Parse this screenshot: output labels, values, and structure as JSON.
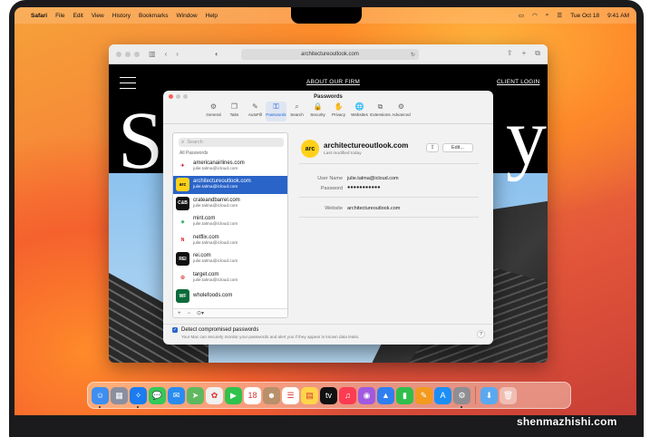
{
  "menubar": {
    "apple_icon": "apple-logo-icon",
    "app_name": "Safari",
    "items": [
      "File",
      "Edit",
      "View",
      "History",
      "Bookmarks",
      "Window",
      "Help"
    ],
    "date": "Tue Oct 18",
    "time": "9:41 AM",
    "status_icons": [
      "battery-icon",
      "wifi-icon",
      "search-icon",
      "control-center-icon"
    ]
  },
  "safari": {
    "url": "architectureoutlook.com",
    "site": {
      "nav_about": "ABOUT OUR FIRM",
      "nav_client": "CLIENT LOGIN",
      "big_left": "S",
      "big_right": "y"
    }
  },
  "passwords": {
    "title": "Passwords",
    "tabs": [
      {
        "label": "General",
        "icon": "gear-icon",
        "glyph": "⚙"
      },
      {
        "label": "Tabs",
        "icon": "tabs-icon",
        "glyph": "❐"
      },
      {
        "label": "AutoFill",
        "icon": "autofill-pen-icon",
        "glyph": "✎"
      },
      {
        "label": "Passwords",
        "icon": "key-icon",
        "glyph": "⚿"
      },
      {
        "label": "Search",
        "icon": "magnifier-icon",
        "glyph": "⌕"
      },
      {
        "label": "Security",
        "icon": "lock-icon",
        "glyph": "🔒"
      },
      {
        "label": "Privacy",
        "icon": "hand-icon",
        "glyph": "✋"
      },
      {
        "label": "Websites",
        "icon": "globe-icon",
        "glyph": "🌐"
      },
      {
        "label": "Extensions",
        "icon": "puzzle-icon",
        "glyph": "⧉"
      },
      {
        "label": "Advanced",
        "icon": "gears-icon",
        "glyph": "⚙"
      }
    ],
    "search_placeholder": "Search",
    "list_header": "All Passwords",
    "items": [
      {
        "site": "americanairlines.com",
        "user": "julie.talma@icloud.com",
        "logo_text": "✈",
        "logo_bg": "#ffffff",
        "logo_fg": "#c8102e"
      },
      {
        "site": "architectureoutlook.com",
        "user": "julie.talma@icloud.com",
        "logo_text": "arc",
        "logo_bg": "#ffd11a",
        "logo_fg": "#111111"
      },
      {
        "site": "crateandbarrel.com",
        "user": "julie.talma@icloud.com",
        "logo_text": "C&B",
        "logo_bg": "#111111",
        "logo_fg": "#ffffff"
      },
      {
        "site": "mint.com",
        "user": "julie.talma@icloud.com",
        "logo_text": "◆",
        "logo_bg": "#ffffff",
        "logo_fg": "#3cb371"
      },
      {
        "site": "netflix.com",
        "user": "julie.talma@icloud.com",
        "logo_text": "N",
        "logo_bg": "#ffffff",
        "logo_fg": "#e50914"
      },
      {
        "site": "rei.com",
        "user": "julie.talma@icloud.com",
        "logo_text": "REI",
        "logo_bg": "#111111",
        "logo_fg": "#ffffff"
      },
      {
        "site": "target.com",
        "user": "julie.talma@icloud.com",
        "logo_text": "◎",
        "logo_bg": "#ffffff",
        "logo_fg": "#cc0000"
      },
      {
        "site": "wholefoods.com",
        "user": "",
        "logo_text": "WF",
        "logo_bg": "#0b6b3a",
        "logo_fg": "#ffffff"
      }
    ],
    "footer": {
      "add": "+",
      "remove": "−",
      "more": "⊙▾"
    },
    "detail": {
      "logo_text": "arc",
      "title": "architectureoutlook.com",
      "subtitle": "Last modified today",
      "share_icon": "share-icon",
      "edit_label": "Edit...",
      "username_label": "User Name",
      "username_value": "julie.talma@icloud.com",
      "password_label": "Password",
      "password_value": "●●●●●●●●●●●",
      "website_label": "Website",
      "website_value": "architectureoutlook.com"
    },
    "detect_label": "Detect compromised passwords",
    "detect_desc": "Your Mac can securely monitor your passwords and alert you if they appear in known data leaks.",
    "help": "?"
  },
  "dock": [
    {
      "name": "finder-icon",
      "glyph": "☺",
      "bg": "#3d8ef0",
      "running": true
    },
    {
      "name": "launchpad-icon",
      "glyph": "▦",
      "bg": "#8a8fa0",
      "running": false
    },
    {
      "name": "safari-icon",
      "glyph": "✧",
      "bg": "#1a7cf0",
      "running": true
    },
    {
      "name": "messages-icon",
      "glyph": "💬",
      "bg": "#34c759",
      "running": false
    },
    {
      "name": "mail-icon",
      "glyph": "✉",
      "bg": "#2a8cf0",
      "running": false
    },
    {
      "name": "maps-icon",
      "glyph": "➤",
      "bg": "#5fb85f",
      "running": false
    },
    {
      "name": "photos-icon",
      "glyph": "✿",
      "bg": "#f0f0f0",
      "running": false
    },
    {
      "name": "facetime-icon",
      "glyph": "▶",
      "bg": "#2fc24d",
      "running": false
    },
    {
      "name": "calendar-icon",
      "glyph": "18",
      "bg": "#ffffff",
      "running": false
    },
    {
      "name": "contacts-icon",
      "glyph": "☻",
      "bg": "#b8906a",
      "running": false
    },
    {
      "name": "reminders-icon",
      "glyph": "☰",
      "bg": "#ffffff",
      "running": false
    },
    {
      "name": "notes-icon",
      "glyph": "▤",
      "bg": "#ffd54a",
      "running": false
    },
    {
      "name": "apple-tv-icon",
      "glyph": "tv",
      "bg": "#111111",
      "running": false
    },
    {
      "name": "music-icon",
      "glyph": "♫",
      "bg": "#fb3c52",
      "running": false
    },
    {
      "name": "podcasts-icon",
      "glyph": "◉",
      "bg": "#a05ae0",
      "running": false
    },
    {
      "name": "keynote-icon",
      "glyph": "▲",
      "bg": "#2f7ff0",
      "running": false
    },
    {
      "name": "numbers-icon",
      "glyph": "▮",
      "bg": "#2fbf4a",
      "running": false
    },
    {
      "name": "pages-icon",
      "glyph": "✎",
      "bg": "#f39a1e",
      "running": false
    },
    {
      "name": "app-store-icon",
      "glyph": "A",
      "bg": "#1c8ef5",
      "running": false
    },
    {
      "name": "system-settings-icon",
      "glyph": "⚙",
      "bg": "#8e8e93",
      "running": true
    },
    {
      "sep": true
    },
    {
      "name": "downloads-folder-icon",
      "glyph": "⬇",
      "bg": "#5aa9f0",
      "running": false
    },
    {
      "name": "trash-icon",
      "glyph": "🗑",
      "bg": "rgba(255,255,255,0.4)",
      "running": false
    }
  ],
  "watermark": "shenmazhishi.com"
}
